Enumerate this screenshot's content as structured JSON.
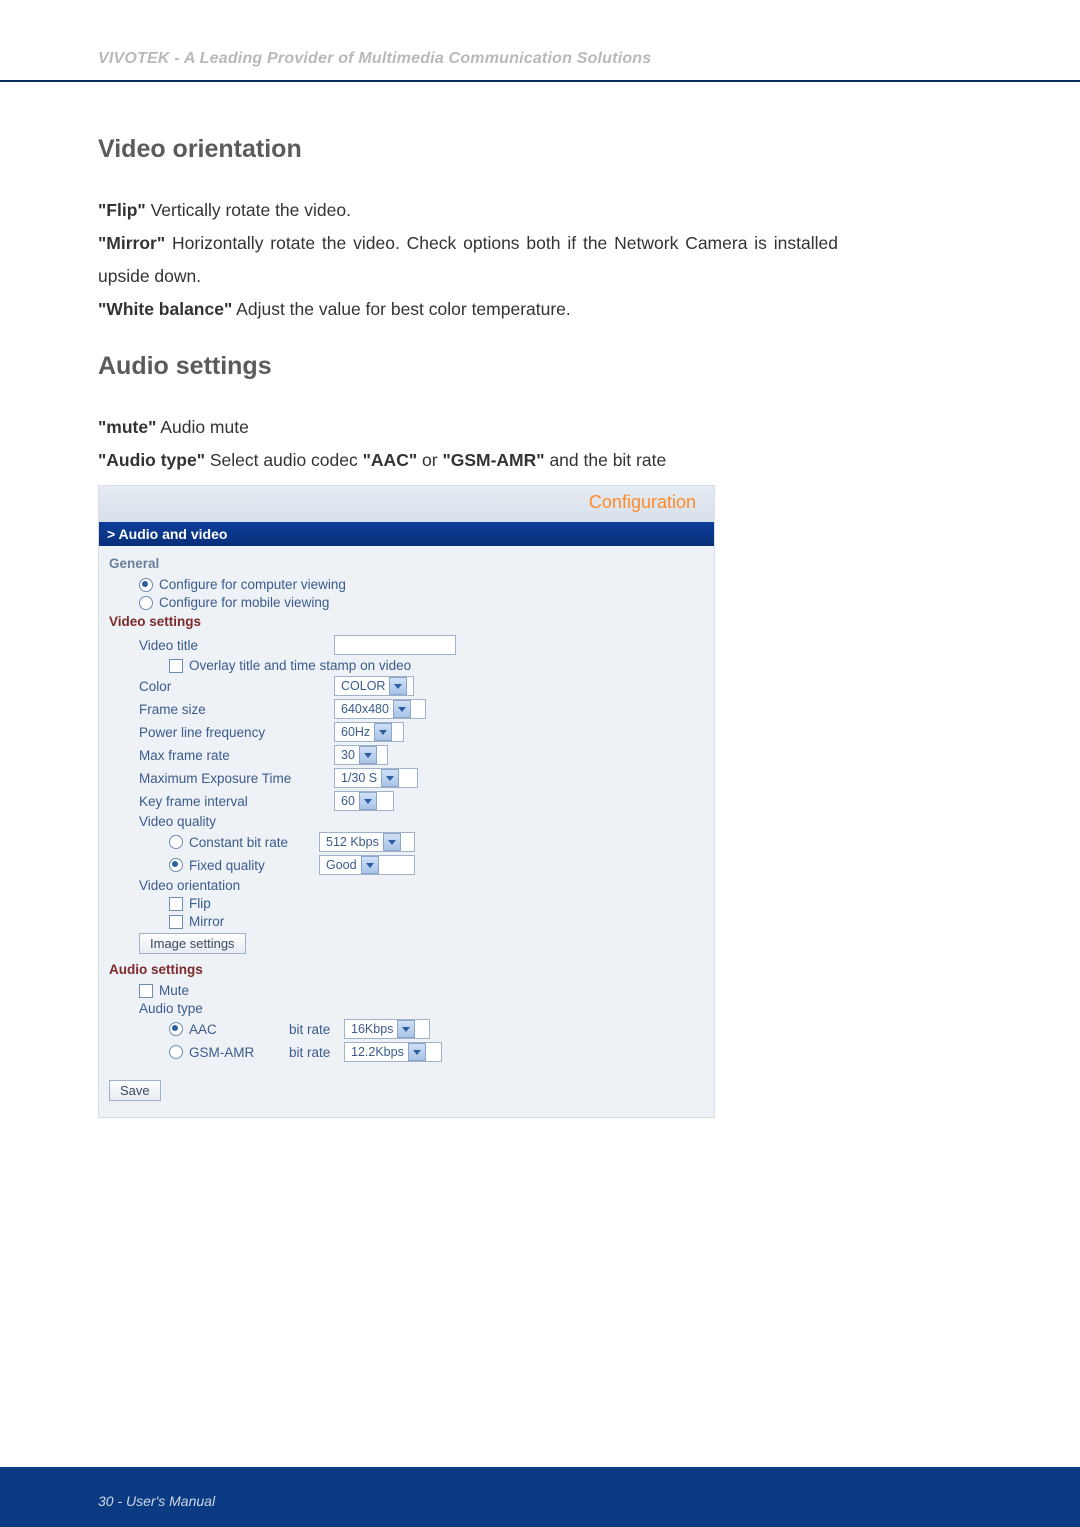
{
  "header": {
    "banner": "VIVOTEK - A Leading Provider of Multimedia Communication Solutions"
  },
  "sections": {
    "video_orientation": {
      "heading": "Video orientation",
      "flip_label": "\"Flip\"",
      "flip_text": " Vertically rotate the video.",
      "mirror_label": "\"Mirror\"",
      "mirror_text": " Horizontally rotate the video. Check options both if the Network Camera is installed upside down.",
      "wb_label": "\"White balance\"",
      "wb_text": " Adjust the value for best color temperature."
    },
    "audio_settings": {
      "heading": "Audio settings",
      "mute_label": "\"mute\"",
      "mute_text": " Audio mute",
      "audiotype_label": "\"Audio type\"",
      "audiotype_text_1": " Select audio codec ",
      "audiotype_aac": "\"AAC\"",
      "audiotype_or": " or ",
      "audiotype_gsm": "\"GSM-AMR\"",
      "audiotype_text_2": " and the bit rate"
    }
  },
  "config": {
    "configuration_label": "Configuration",
    "section_bar": "> Audio and video",
    "general_heading": "General",
    "general_opt1": "Configure for computer viewing",
    "general_opt2": "Configure for mobile viewing",
    "video_heading": "Video settings",
    "video_title_label": "Video title",
    "overlay_label": "Overlay title and time stamp on video",
    "color_label": "Color",
    "color_value": "COLOR",
    "frame_size_label": "Frame size",
    "frame_size_value": "640x480",
    "plf_label": "Power line frequency",
    "plf_value": "60Hz",
    "mfr_label": "Max frame rate",
    "mfr_value": "30",
    "met_label": "Maximum Exposure Time",
    "met_value": "1/30 S",
    "kfi_label": "Key frame interval",
    "kfi_value": "60",
    "vq_label": "Video quality",
    "cbr_label": "Constant bit rate",
    "cbr_value": "512 Kbps",
    "fq_label": "Fixed quality",
    "fq_value": "Good",
    "vo_label": "Video orientation",
    "flip_label": "Flip",
    "mirror_label": "Mirror",
    "image_settings_btn": "Image settings",
    "audio_heading": "Audio settings",
    "mute_label": "Mute",
    "audio_type_label": "Audio type",
    "aac_label": "AAC",
    "bitrate_label": "bit rate",
    "aac_bitrate_value": "16Kbps",
    "gsm_label": "GSM-AMR",
    "gsm_bitrate_value": "12.2Kbps",
    "save_btn": "Save"
  },
  "footer": {
    "text": "30 - User's Manual"
  }
}
